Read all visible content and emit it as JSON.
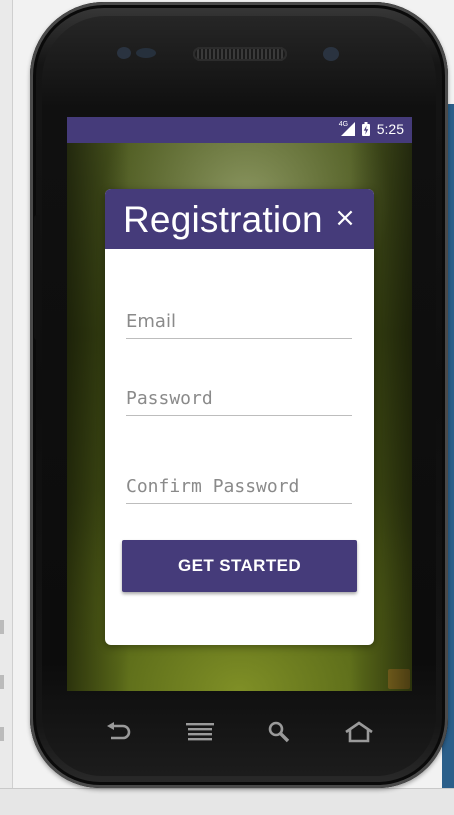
{
  "statusbar": {
    "network_type": "4G",
    "time": "5:25"
  },
  "dialog": {
    "title": "Registration",
    "close_symbol": "×",
    "fields": {
      "email": {
        "placeholder": "Email",
        "value": ""
      },
      "password": {
        "placeholder": "Password",
        "value": ""
      },
      "confirm_password": {
        "placeholder": "Confirm Password",
        "value": ""
      }
    },
    "submit_label": "GET STARTED"
  },
  "hardware_keys": [
    "back-icon",
    "menu-icon",
    "search-icon",
    "home-icon"
  ],
  "colors": {
    "primary": "#453b7a",
    "dialog_background": "#ffffff",
    "input_underline": "#bdbdbd",
    "placeholder_text": "#8a8a8a"
  }
}
